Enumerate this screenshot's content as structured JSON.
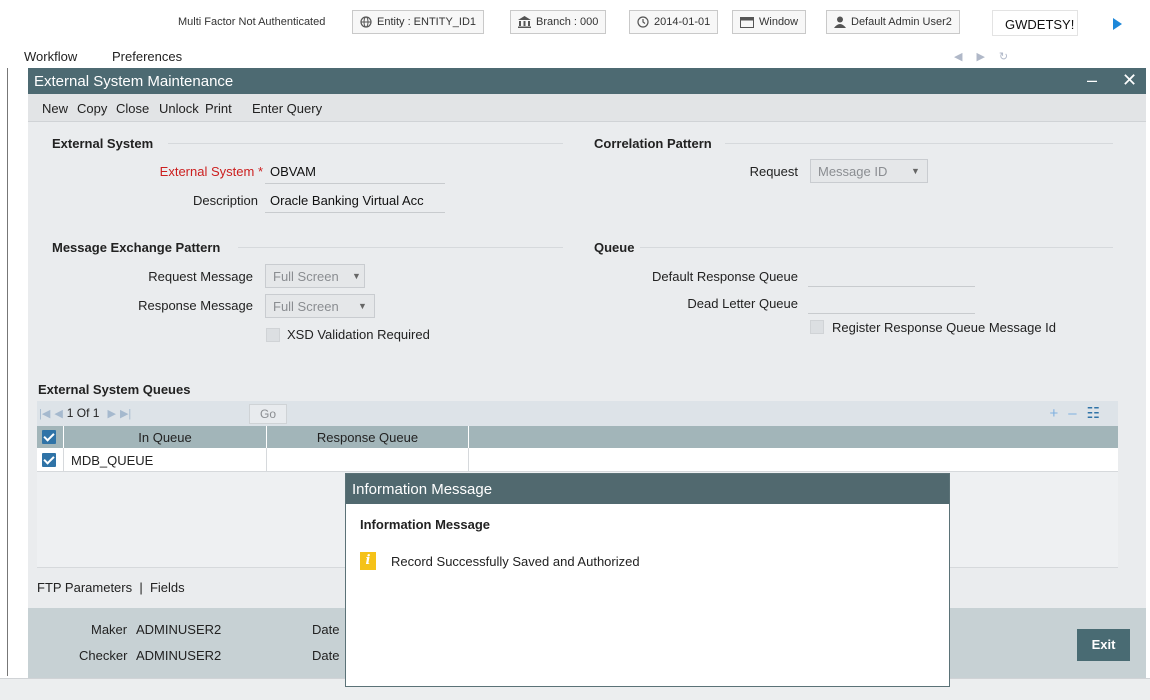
{
  "topbar": {
    "mfa_status": "Multi Factor Not Authenticated",
    "entity": "Entity : ENTITY_ID1",
    "branch": "Branch : 000",
    "date": "2014-01-01",
    "window": "Window",
    "user": "Default Admin User2",
    "function_id": "GWDETSY!"
  },
  "menu": {
    "items": [
      "Workflow",
      "Preferences"
    ]
  },
  "window": {
    "title": "External System Maintenance",
    "toolbar": [
      "New",
      "Copy",
      "Close",
      "Unlock",
      "Print",
      "Enter Query"
    ]
  },
  "form": {
    "external_system": {
      "section": "External System",
      "system_label": "External System",
      "system_value": "OBVAM",
      "description_label": "Description",
      "description_value": "Oracle Banking Virtual Acc"
    },
    "correlation": {
      "section": "Correlation Pattern",
      "request_label": "Request",
      "request_value": "Message ID"
    },
    "exchange": {
      "section": "Message Exchange Pattern",
      "request_label": "Request Message",
      "request_value": "Full Screen",
      "response_label": "Response Message",
      "response_value": "Full Screen",
      "xsd_label": "XSD Validation Required"
    },
    "queue": {
      "section": "Queue",
      "default_response_label": "Default Response Queue",
      "dead_letter_label": "Dead Letter Queue",
      "register_label": "Register Response Queue Message Id"
    }
  },
  "queues": {
    "title": "External System Queues",
    "pager": "1 Of 1",
    "go_label": "Go",
    "headers": [
      "In Queue",
      "Response Queue"
    ],
    "rows": [
      {
        "in_queue": "MDB_QUEUE",
        "response_queue": ""
      }
    ]
  },
  "subtabs": "FTP Parameters  |  Fields",
  "footer": {
    "maker_label": "Maker",
    "maker_value": "ADMINUSER2",
    "checker_label": "Checker",
    "checker_value": "ADMINUSER2",
    "date_label": "Date",
    "exit_label": "Exit"
  },
  "modal": {
    "title": "Information Message",
    "heading": "Information Message",
    "message": "Record Successfully Saved and Authorized"
  },
  "colors": {
    "title_bar": "#4d6a72",
    "grid_header": "#a2b5b9",
    "footer": "#c7d1d4",
    "info_icon": "#f5c218",
    "required": "#cc1f1f"
  }
}
